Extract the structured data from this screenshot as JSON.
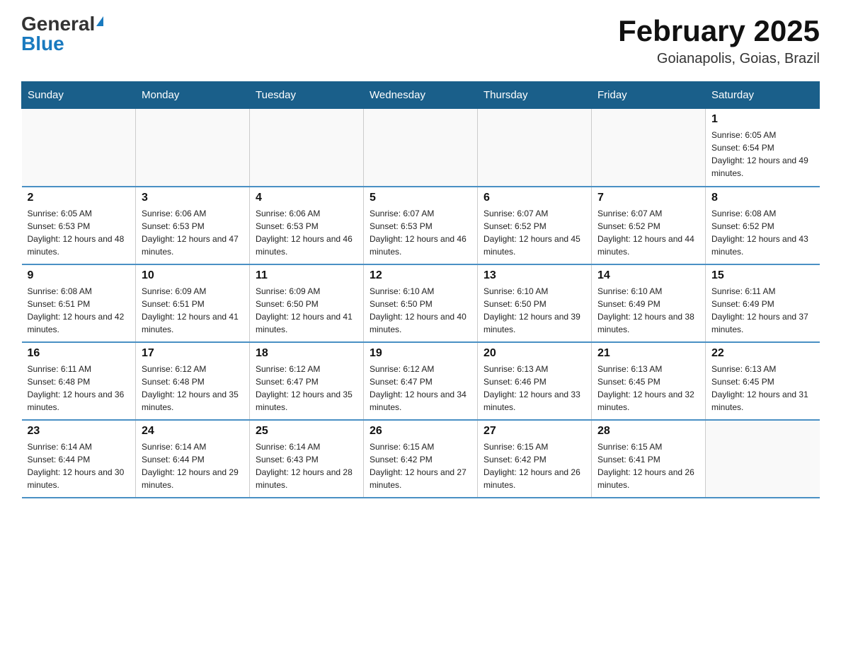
{
  "logo": {
    "general": "General",
    "blue": "Blue"
  },
  "title": "February 2025",
  "subtitle": "Goianapolis, Goias, Brazil",
  "days_of_week": [
    "Sunday",
    "Monday",
    "Tuesday",
    "Wednesday",
    "Thursday",
    "Friday",
    "Saturday"
  ],
  "weeks": [
    [
      {
        "day": "",
        "info": ""
      },
      {
        "day": "",
        "info": ""
      },
      {
        "day": "",
        "info": ""
      },
      {
        "day": "",
        "info": ""
      },
      {
        "day": "",
        "info": ""
      },
      {
        "day": "",
        "info": ""
      },
      {
        "day": "1",
        "info": "Sunrise: 6:05 AM\nSunset: 6:54 PM\nDaylight: 12 hours and 49 minutes."
      }
    ],
    [
      {
        "day": "2",
        "info": "Sunrise: 6:05 AM\nSunset: 6:53 PM\nDaylight: 12 hours and 48 minutes."
      },
      {
        "day": "3",
        "info": "Sunrise: 6:06 AM\nSunset: 6:53 PM\nDaylight: 12 hours and 47 minutes."
      },
      {
        "day": "4",
        "info": "Sunrise: 6:06 AM\nSunset: 6:53 PM\nDaylight: 12 hours and 46 minutes."
      },
      {
        "day": "5",
        "info": "Sunrise: 6:07 AM\nSunset: 6:53 PM\nDaylight: 12 hours and 46 minutes."
      },
      {
        "day": "6",
        "info": "Sunrise: 6:07 AM\nSunset: 6:52 PM\nDaylight: 12 hours and 45 minutes."
      },
      {
        "day": "7",
        "info": "Sunrise: 6:07 AM\nSunset: 6:52 PM\nDaylight: 12 hours and 44 minutes."
      },
      {
        "day": "8",
        "info": "Sunrise: 6:08 AM\nSunset: 6:52 PM\nDaylight: 12 hours and 43 minutes."
      }
    ],
    [
      {
        "day": "9",
        "info": "Sunrise: 6:08 AM\nSunset: 6:51 PM\nDaylight: 12 hours and 42 minutes."
      },
      {
        "day": "10",
        "info": "Sunrise: 6:09 AM\nSunset: 6:51 PM\nDaylight: 12 hours and 41 minutes."
      },
      {
        "day": "11",
        "info": "Sunrise: 6:09 AM\nSunset: 6:50 PM\nDaylight: 12 hours and 41 minutes."
      },
      {
        "day": "12",
        "info": "Sunrise: 6:10 AM\nSunset: 6:50 PM\nDaylight: 12 hours and 40 minutes."
      },
      {
        "day": "13",
        "info": "Sunrise: 6:10 AM\nSunset: 6:50 PM\nDaylight: 12 hours and 39 minutes."
      },
      {
        "day": "14",
        "info": "Sunrise: 6:10 AM\nSunset: 6:49 PM\nDaylight: 12 hours and 38 minutes."
      },
      {
        "day": "15",
        "info": "Sunrise: 6:11 AM\nSunset: 6:49 PM\nDaylight: 12 hours and 37 minutes."
      }
    ],
    [
      {
        "day": "16",
        "info": "Sunrise: 6:11 AM\nSunset: 6:48 PM\nDaylight: 12 hours and 36 minutes."
      },
      {
        "day": "17",
        "info": "Sunrise: 6:12 AM\nSunset: 6:48 PM\nDaylight: 12 hours and 35 minutes."
      },
      {
        "day": "18",
        "info": "Sunrise: 6:12 AM\nSunset: 6:47 PM\nDaylight: 12 hours and 35 minutes."
      },
      {
        "day": "19",
        "info": "Sunrise: 6:12 AM\nSunset: 6:47 PM\nDaylight: 12 hours and 34 minutes."
      },
      {
        "day": "20",
        "info": "Sunrise: 6:13 AM\nSunset: 6:46 PM\nDaylight: 12 hours and 33 minutes."
      },
      {
        "day": "21",
        "info": "Sunrise: 6:13 AM\nSunset: 6:45 PM\nDaylight: 12 hours and 32 minutes."
      },
      {
        "day": "22",
        "info": "Sunrise: 6:13 AM\nSunset: 6:45 PM\nDaylight: 12 hours and 31 minutes."
      }
    ],
    [
      {
        "day": "23",
        "info": "Sunrise: 6:14 AM\nSunset: 6:44 PM\nDaylight: 12 hours and 30 minutes."
      },
      {
        "day": "24",
        "info": "Sunrise: 6:14 AM\nSunset: 6:44 PM\nDaylight: 12 hours and 29 minutes."
      },
      {
        "day": "25",
        "info": "Sunrise: 6:14 AM\nSunset: 6:43 PM\nDaylight: 12 hours and 28 minutes."
      },
      {
        "day": "26",
        "info": "Sunrise: 6:15 AM\nSunset: 6:42 PM\nDaylight: 12 hours and 27 minutes."
      },
      {
        "day": "27",
        "info": "Sunrise: 6:15 AM\nSunset: 6:42 PM\nDaylight: 12 hours and 26 minutes."
      },
      {
        "day": "28",
        "info": "Sunrise: 6:15 AM\nSunset: 6:41 PM\nDaylight: 12 hours and 26 minutes."
      },
      {
        "day": "",
        "info": ""
      }
    ]
  ]
}
